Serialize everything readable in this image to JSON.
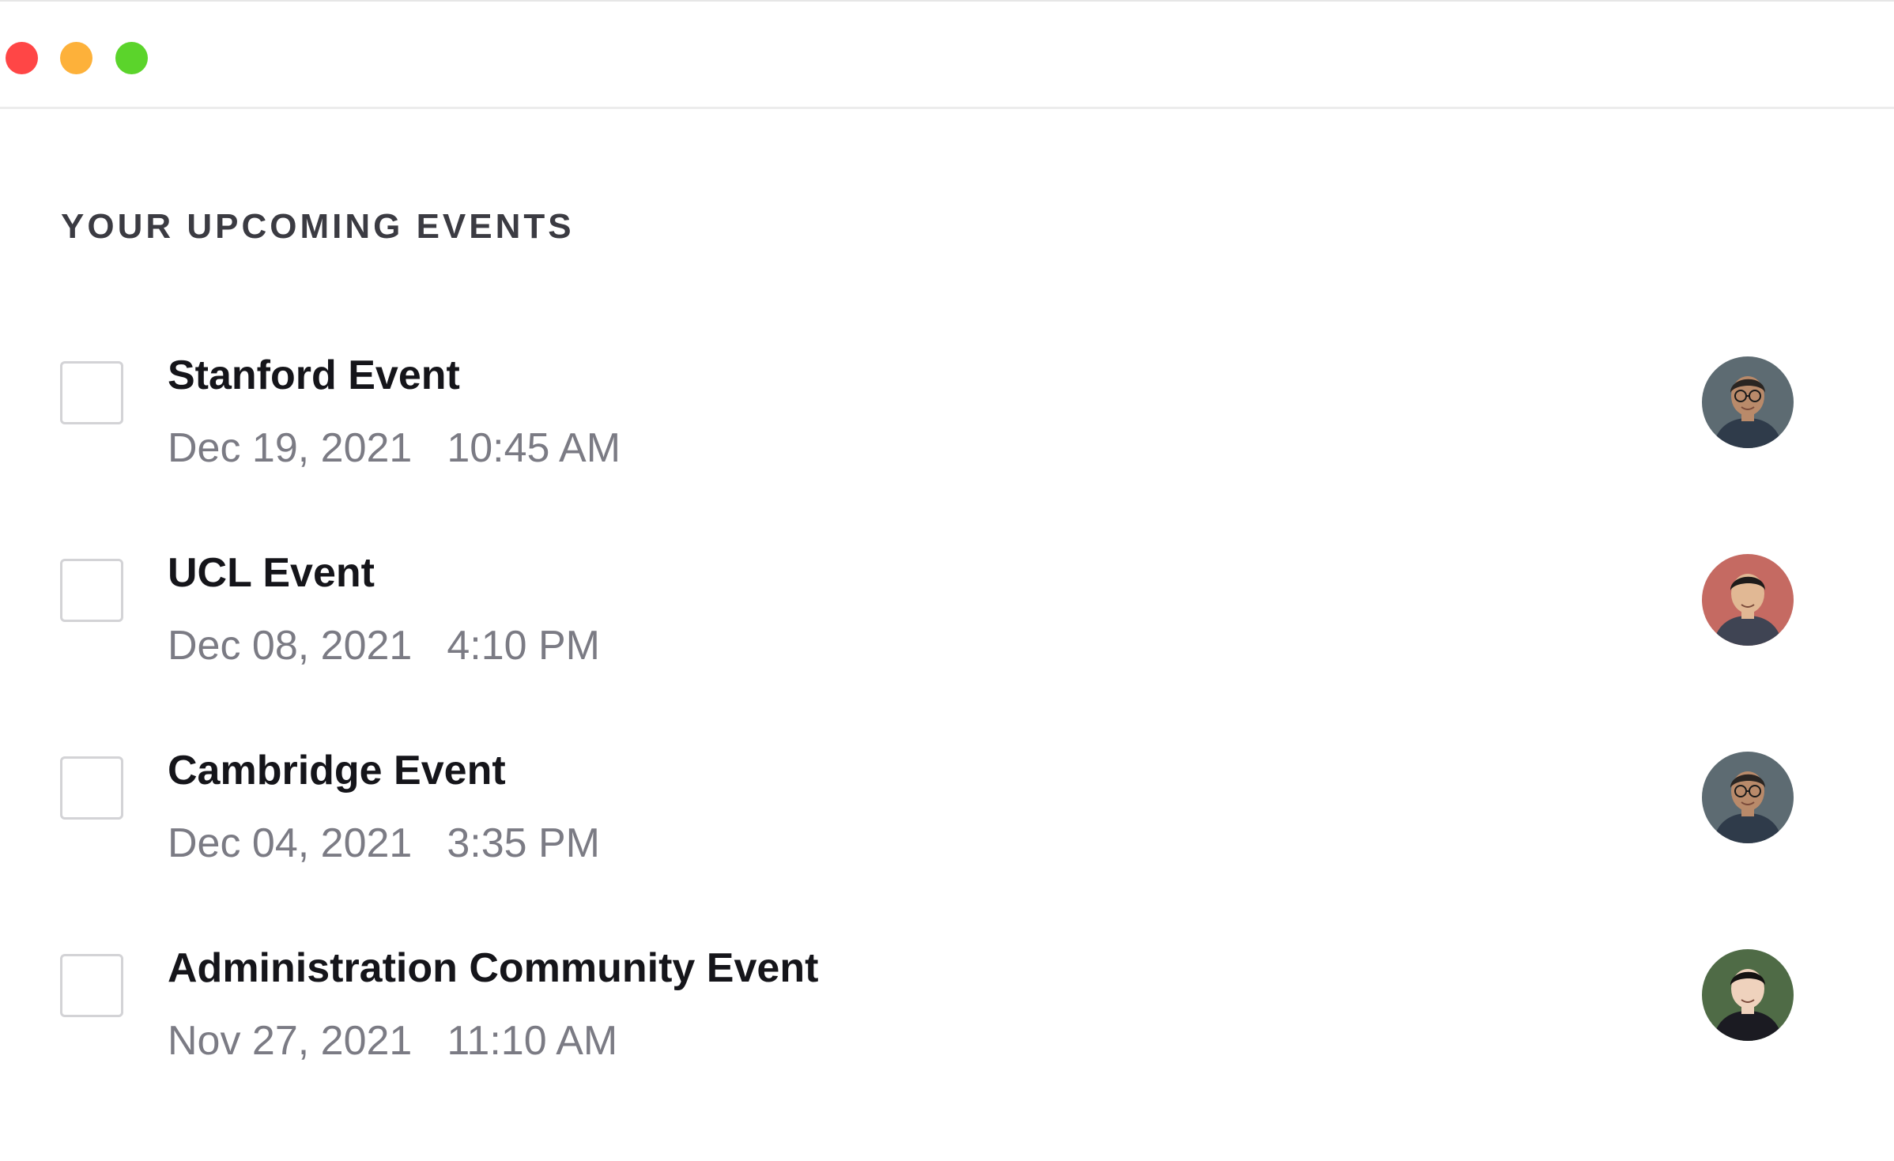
{
  "window": {
    "controls": [
      "close",
      "minimize",
      "maximize"
    ]
  },
  "section": {
    "title": "YOUR UPCOMING EVENTS"
  },
  "events": [
    {
      "title": "Stanford Event",
      "date": "Dec 19, 2021",
      "time": "10:45 AM",
      "checked": false,
      "avatar": {
        "icon": "person-avatar",
        "skin": "#b98a6a",
        "hair": "#2a2522",
        "bg": "#5d6b72",
        "clothes": "#2f3b4a",
        "glasses": true
      }
    },
    {
      "title": "UCL Event",
      "date": "Dec 08, 2021",
      "time": "4:10 PM",
      "checked": false,
      "avatar": {
        "icon": "person-avatar",
        "skin": "#e1b894",
        "hair": "#1e1b1a",
        "bg": "#c56a62",
        "clothes": "#3f4453",
        "glasses": false
      }
    },
    {
      "title": "Cambridge Event",
      "date": "Dec 04, 2021",
      "time": "3:35 PM",
      "checked": false,
      "avatar": {
        "icon": "person-avatar",
        "skin": "#b98a6a",
        "hair": "#2a2522",
        "bg": "#5d6b72",
        "clothes": "#2f3b4a",
        "glasses": true
      }
    },
    {
      "title": "Administration Community Event",
      "date": "Nov 27, 2021",
      "time": "11:10 AM",
      "checked": false,
      "avatar": {
        "icon": "person-avatar",
        "skin": "#efd2bd",
        "hair": "#141212",
        "bg": "#4f6b46",
        "clothes": "#1b1b22",
        "glasses": false
      }
    }
  ]
}
